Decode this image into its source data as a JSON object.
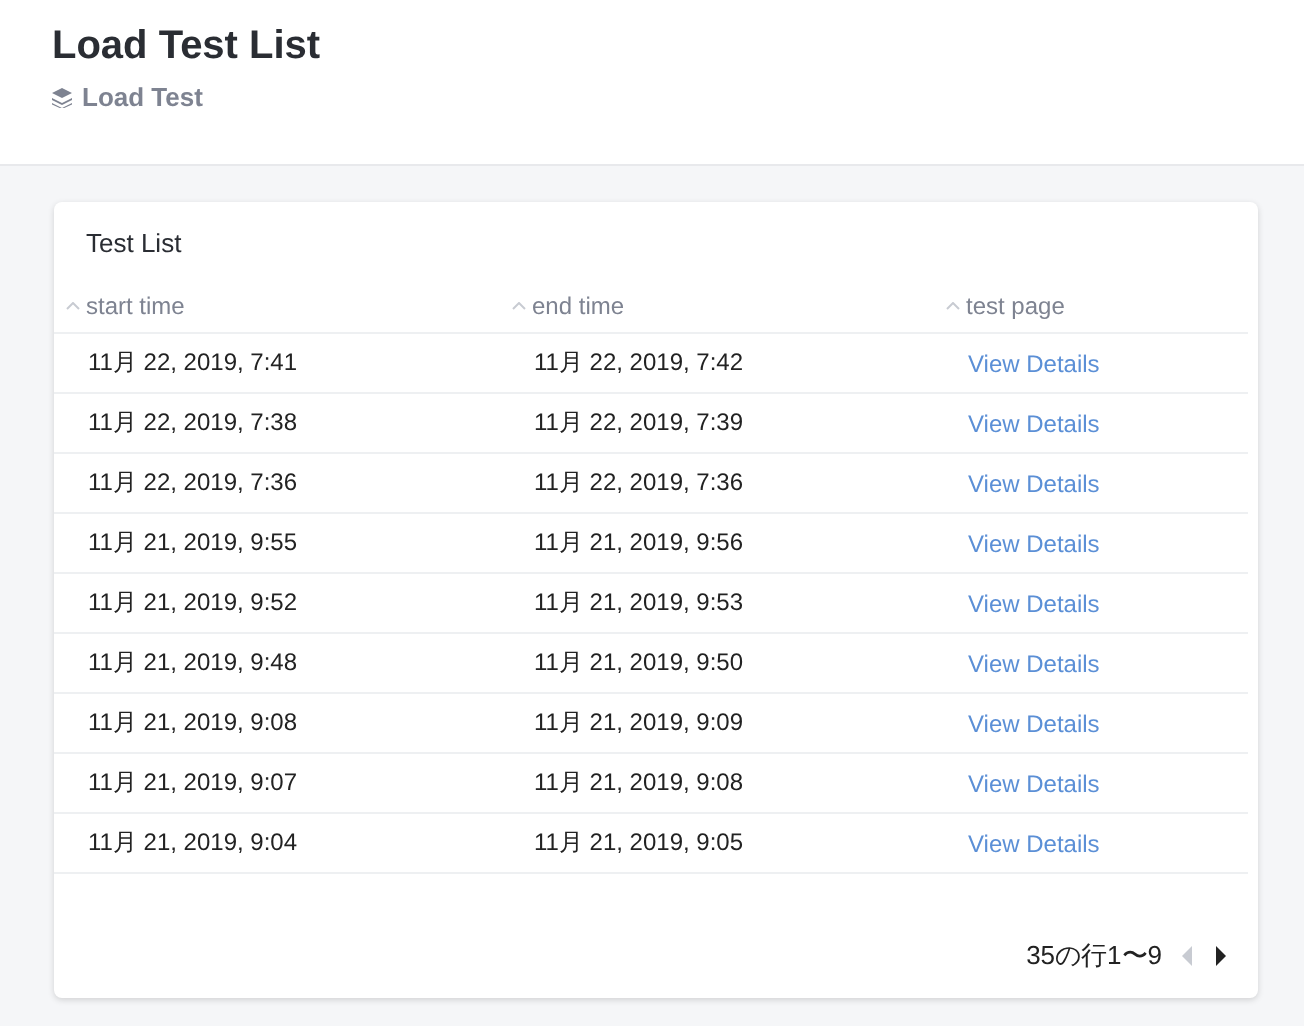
{
  "page": {
    "title": "Load Test List",
    "breadcrumb": "Load Test"
  },
  "card": {
    "title": "Test List",
    "columns": [
      {
        "label": "start time"
      },
      {
        "label": "end time"
      },
      {
        "label": "test page"
      }
    ],
    "rows": [
      {
        "start": "11月 22, 2019, 7:41",
        "end": "11月 22, 2019, 7:42",
        "link": "View Details"
      },
      {
        "start": "11月 22, 2019, 7:38",
        "end": "11月 22, 2019, 7:39",
        "link": "View Details"
      },
      {
        "start": "11月 22, 2019, 7:36",
        "end": "11月 22, 2019, 7:36",
        "link": "View Details"
      },
      {
        "start": "11月 21, 2019, 9:55",
        "end": "11月 21, 2019, 9:56",
        "link": "View Details"
      },
      {
        "start": "11月 21, 2019, 9:52",
        "end": "11月 21, 2019, 9:53",
        "link": "View Details"
      },
      {
        "start": "11月 21, 2019, 9:48",
        "end": "11月 21, 2019, 9:50",
        "link": "View Details"
      },
      {
        "start": "11月 21, 2019, 9:08",
        "end": "11月 21, 2019, 9:09",
        "link": "View Details"
      },
      {
        "start": "11月 21, 2019, 9:07",
        "end": "11月 21, 2019, 9:08",
        "link": "View Details"
      },
      {
        "start": "11月 21, 2019, 9:04",
        "end": "11月 21, 2019, 9:05",
        "link": "View Details"
      }
    ],
    "pagination": {
      "text": "35の行1〜9",
      "prev_disabled": true,
      "next_disabled": false
    }
  }
}
